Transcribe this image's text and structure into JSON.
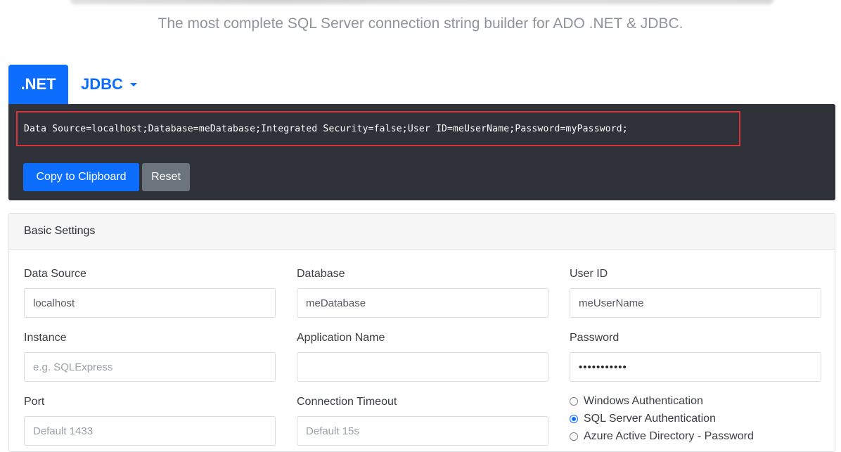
{
  "header": {
    "subtitle": "The most complete SQL Server connection string builder for ADO .NET & JDBC."
  },
  "tabs": [
    {
      "label": ".NET",
      "active": true
    },
    {
      "label": "JDBC",
      "active": false
    }
  ],
  "output": {
    "connection_string": "Data Source=localhost;Database=meDatabase;Integrated Security=false;User ID=meUserName;Password=myPassword;",
    "copy_label": "Copy to Clipboard",
    "reset_label": "Reset"
  },
  "basic_settings": {
    "title": "Basic Settings",
    "data_source": {
      "label": "Data Source",
      "value": "localhost"
    },
    "database": {
      "label": "Database",
      "value": "meDatabase"
    },
    "user_id": {
      "label": "User ID",
      "value": "meUserName"
    },
    "instance": {
      "label": "Instance",
      "placeholder": "e.g. SQLExpress"
    },
    "application_name": {
      "label": "Application Name",
      "value": ""
    },
    "password": {
      "label": "Password",
      "value": "•••••••••••"
    },
    "port": {
      "label": "Port",
      "placeholder": "Default 1433"
    },
    "connection_timeout": {
      "label": "Connection Timeout",
      "placeholder": "Default 15s"
    },
    "auth_options": [
      {
        "label": "Windows Authentication",
        "selected": false
      },
      {
        "label": "SQL Server Authentication",
        "selected": true
      },
      {
        "label": "Azure Active Directory - Password",
        "selected": false
      }
    ]
  },
  "colors": {
    "primary": "#0d6efd",
    "secondary": "#6c757d",
    "dark_panel": "#2f3238",
    "highlight_border": "#d9323b"
  }
}
